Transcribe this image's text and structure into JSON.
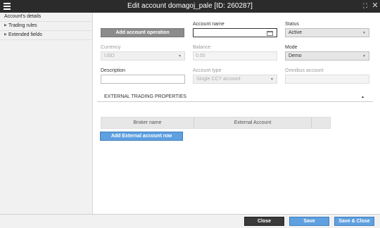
{
  "window": {
    "title": "Edit account domagoj_pale [ID: 260287]",
    "menu_icon": "hamburger-icon",
    "maximize_icon": "maximize-icon",
    "close_icon": "close-icon"
  },
  "sidebar": {
    "items": [
      {
        "label": "Account's details",
        "active": true
      },
      {
        "label": "Trading rules",
        "expandable": true
      },
      {
        "label": "Extended fields",
        "expandable": true
      }
    ]
  },
  "form": {
    "add_operation_label": "Add account operation",
    "account_name_label": "Account name",
    "account_name_value": "",
    "status_label": "Status",
    "status_value": "Active",
    "currency_label": "Currency",
    "currency_value": "USD",
    "balance_label": "Balance",
    "balance_value": "0.00",
    "mode_label": "Mode",
    "mode_value": "Demo",
    "description_label": "Description",
    "description_value": "",
    "account_type_label": "Account type",
    "account_type_value": "Single CCY account",
    "omnibus_label": "Omnibus account",
    "omnibus_value": ""
  },
  "external": {
    "section_title": "EXTERNAL TRADING PROPERTIES",
    "columns": [
      "Broker name",
      "External Account",
      ""
    ],
    "add_row_label": "Add External account row"
  },
  "footer": {
    "close_label": "Close",
    "save_label": "Save",
    "save_close_label": "Save & Close"
  },
  "colors": {
    "titlebar": "#2b2b2b",
    "accent_blue": "#5fa0e0",
    "dark_button": "#3a3a3a"
  }
}
